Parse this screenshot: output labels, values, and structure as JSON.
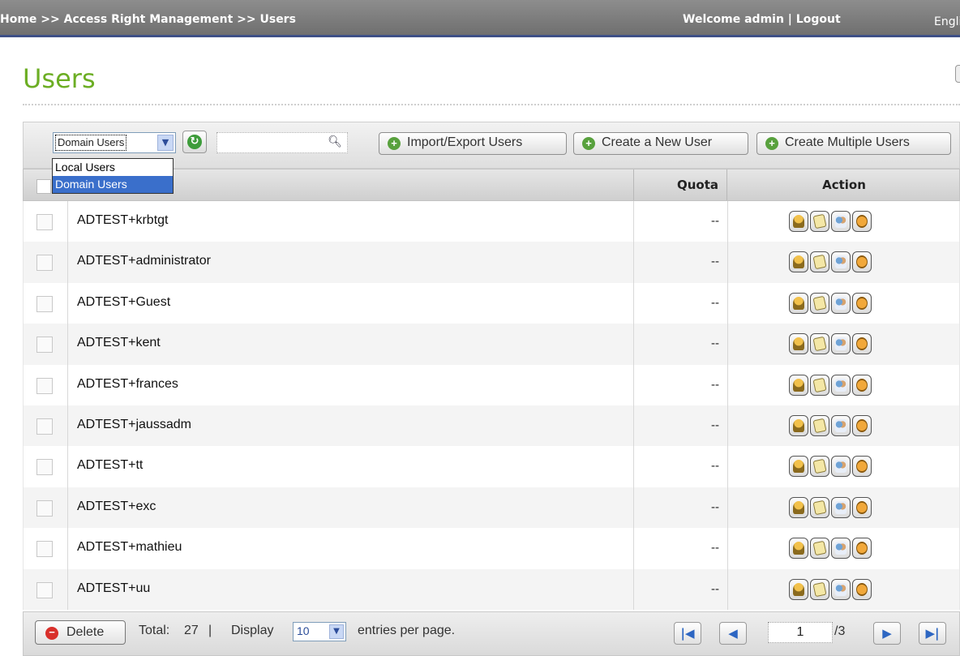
{
  "header": {
    "breadcrumb": "Home >> Access Right Management >> Users",
    "welcome": "Welcome admin | Logout",
    "language": "Englis"
  },
  "page_title": "Users",
  "toolbar": {
    "user_type_selected": "Domain Users",
    "user_type_options": [
      "Local Users",
      "Domain Users"
    ],
    "search_value": "",
    "import_export_label": "Import/Export Users",
    "create_user_label": "Create a New User",
    "create_multiple_label": "Create Multiple Users"
  },
  "table": {
    "columns": {
      "quota": "Quota",
      "action": "Action"
    },
    "rows": [
      {
        "name": "ADTEST+krbtgt",
        "quota": "--"
      },
      {
        "name": "ADTEST+administrator",
        "quota": "--"
      },
      {
        "name": "ADTEST+Guest",
        "quota": "--"
      },
      {
        "name": "ADTEST+kent",
        "quota": "--"
      },
      {
        "name": "ADTEST+frances",
        "quota": "--"
      },
      {
        "name": "ADTEST+jaussadm",
        "quota": "--"
      },
      {
        "name": "ADTEST+tt",
        "quota": "--"
      },
      {
        "name": "ADTEST+exc",
        "quota": "--"
      },
      {
        "name": "ADTEST+mathieu",
        "quota": "--"
      },
      {
        "name": "ADTEST+uu",
        "quota": "--"
      }
    ],
    "action_icons": [
      "key-icon",
      "edit-icon",
      "user-group-icon",
      "share-folder-icon"
    ]
  },
  "footer": {
    "delete_label": "Delete",
    "total_label": "Total:",
    "total_value": "27",
    "display_label": "Display",
    "per_page_value": "10",
    "entries_label": "entries per page.",
    "current_page": "1",
    "total_pages": "/3"
  },
  "colors": {
    "title_green": "#6cae24",
    "topbar_gray": "#7f7f7f",
    "selected_blue": "#3a6fcb"
  }
}
